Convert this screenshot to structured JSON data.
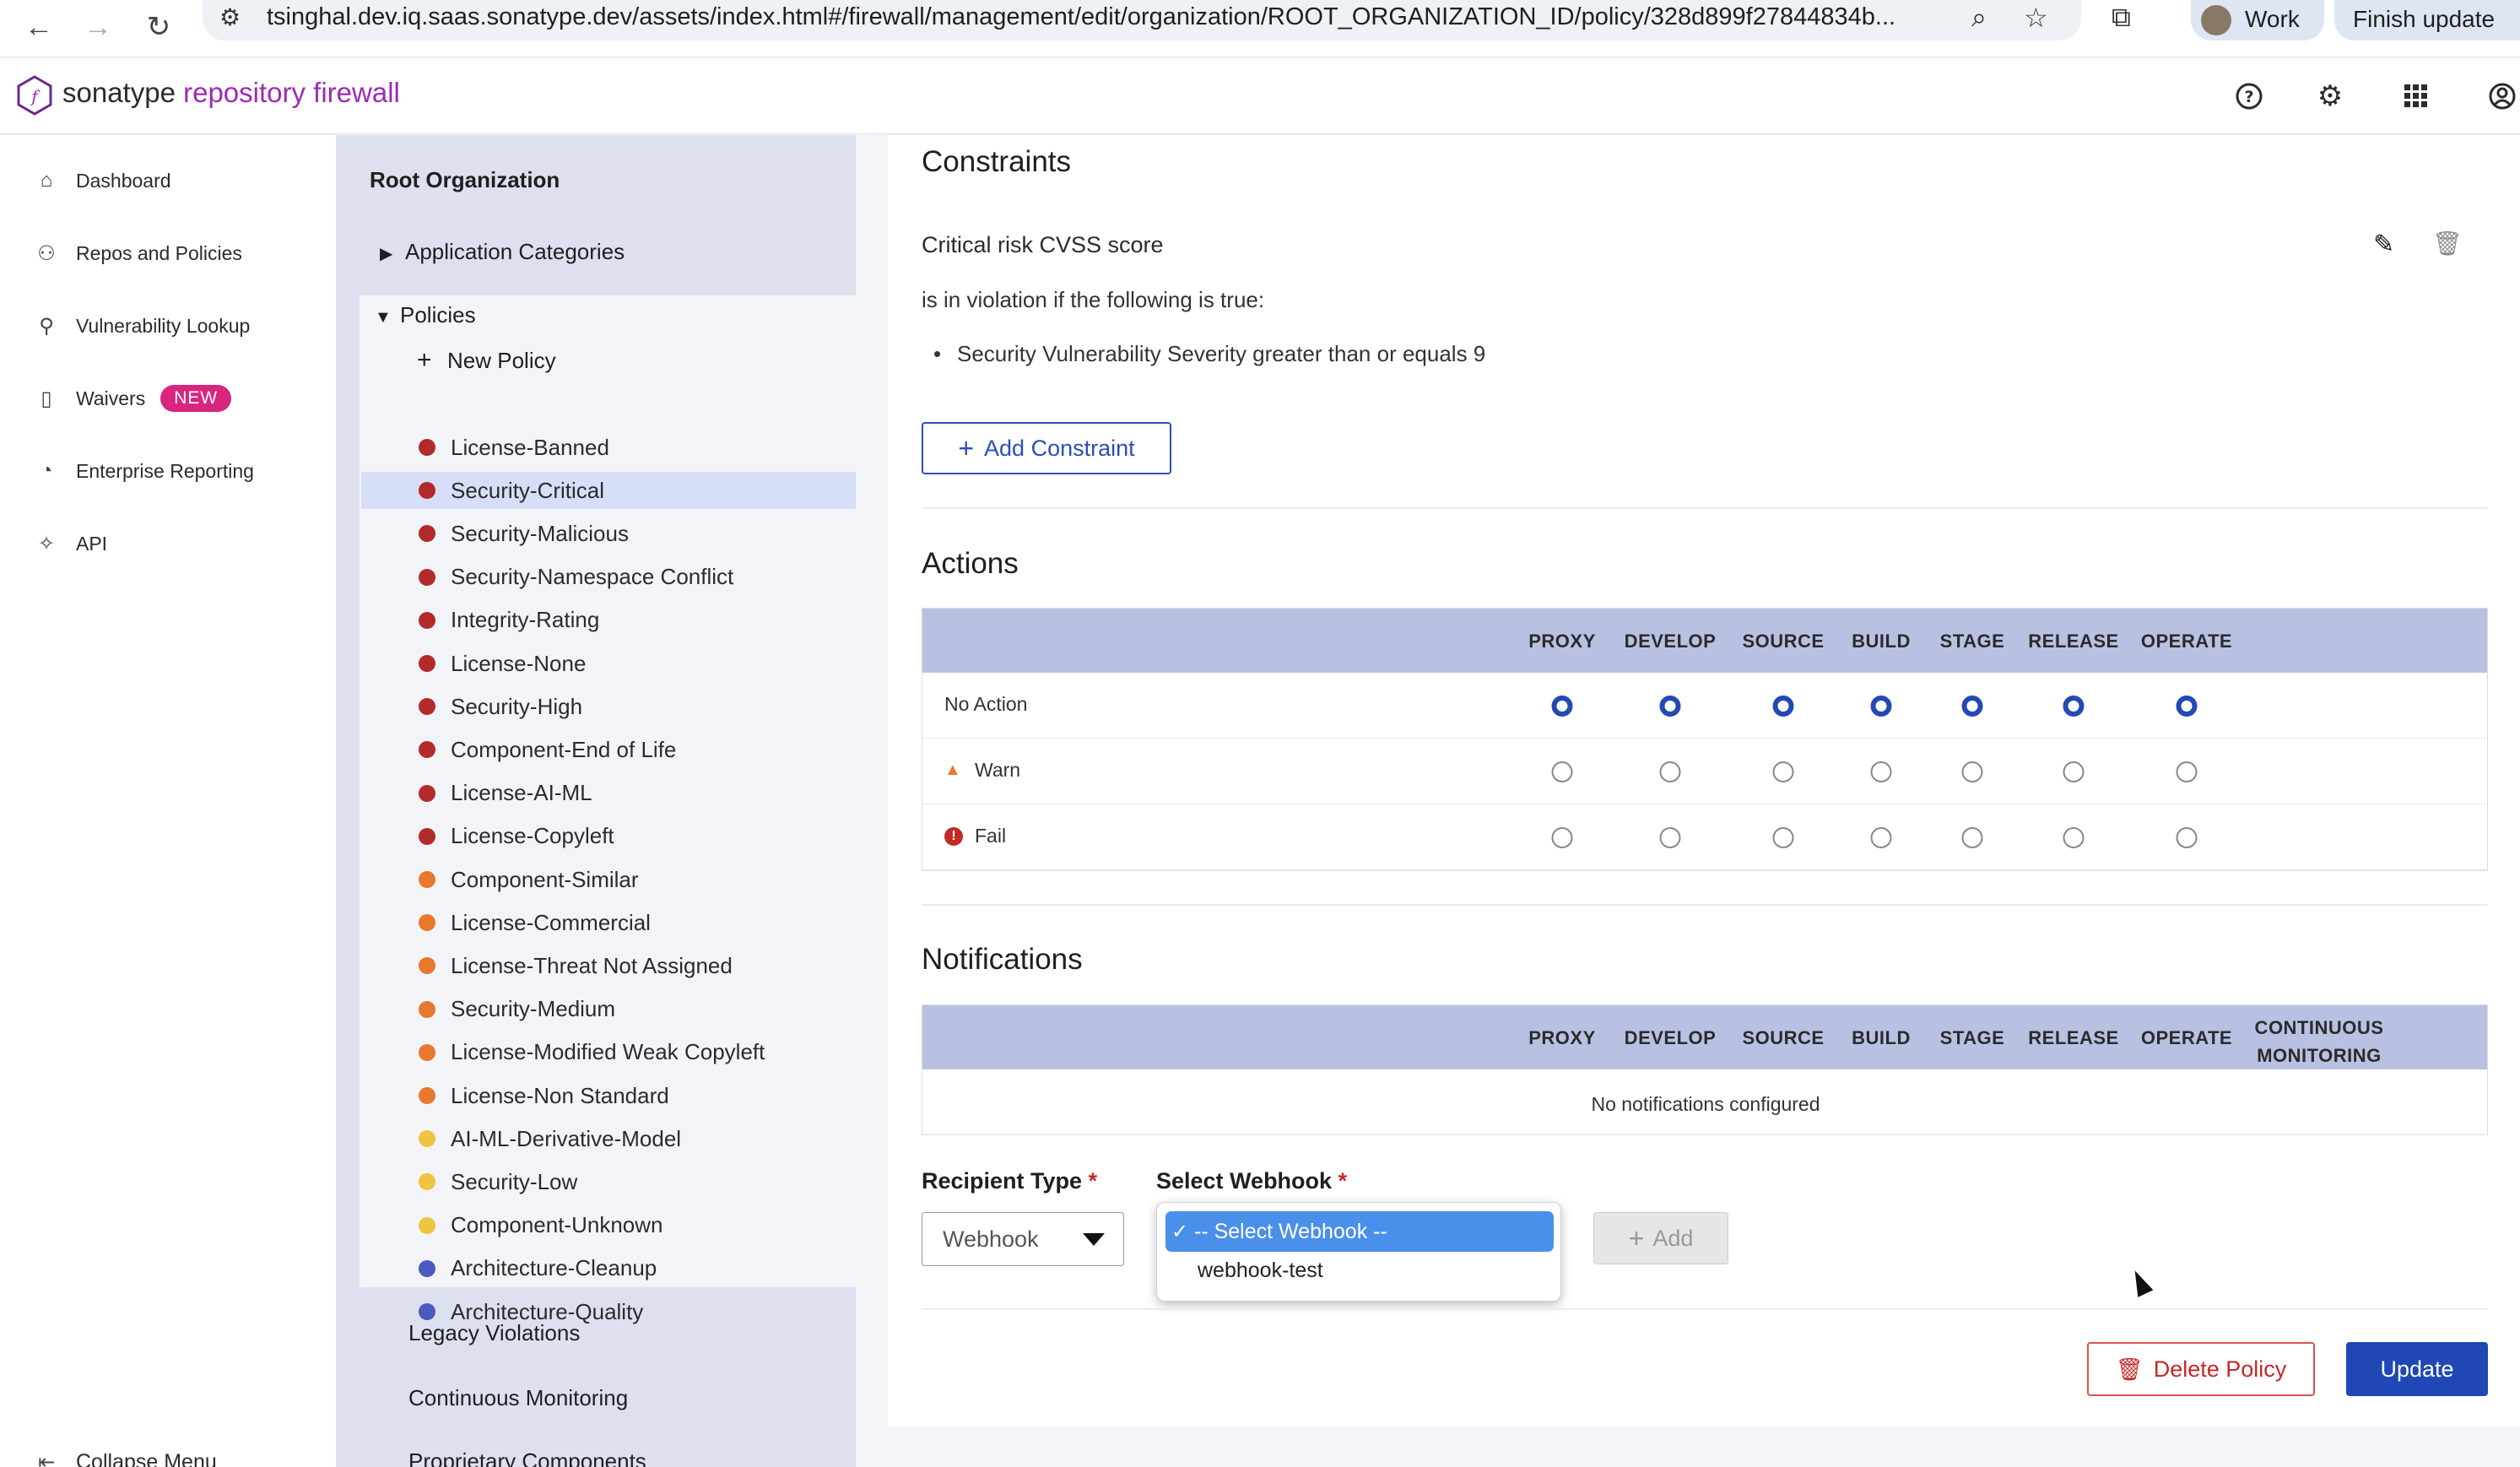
{
  "browser": {
    "url": "tsinghal.dev.iq.saas.sonatype.dev/assets/index.html#/firewall/management/edit/organization/ROOT_ORGANIZATION_ID/policy/328d899f27844834b...",
    "profile_label": "Work",
    "finish_update_label": "Finish update"
  },
  "app": {
    "brand_part1": "sonatype",
    "brand_part2": "repository firewall"
  },
  "leftnav": {
    "items": [
      {
        "label": "Dashboard"
      },
      {
        "label": "Repos and Policies"
      },
      {
        "label": "Vulnerability Lookup"
      },
      {
        "label": "Waivers",
        "badge": "NEW"
      },
      {
        "label": "Enterprise Reporting"
      },
      {
        "label": "API"
      }
    ],
    "collapse_label": "Collapse Menu"
  },
  "tree": {
    "root_label": "Root Organization",
    "app_categories_label": "Application Categories",
    "policies_label": "Policies",
    "new_policy_label": "New Policy",
    "policies": [
      {
        "name": "License-Banned",
        "color": "#b22a2a"
      },
      {
        "name": "Security-Critical",
        "color": "#b22a2a"
      },
      {
        "name": "Security-Malicious",
        "color": "#b22a2a"
      },
      {
        "name": "Security-Namespace Conflict",
        "color": "#b22a2a"
      },
      {
        "name": "Integrity-Rating",
        "color": "#b22a2a"
      },
      {
        "name": "License-None",
        "color": "#b22a2a"
      },
      {
        "name": "Security-High",
        "color": "#b22a2a"
      },
      {
        "name": "Component-End of Life",
        "color": "#b22a2a"
      },
      {
        "name": "License-AI-ML",
        "color": "#b22a2a"
      },
      {
        "name": "License-Copyleft",
        "color": "#b22a2a"
      },
      {
        "name": "Component-Similar",
        "color": "#e8782e"
      },
      {
        "name": "License-Commercial",
        "color": "#e8782e"
      },
      {
        "name": "License-Threat Not Assigned",
        "color": "#e8782e"
      },
      {
        "name": "Security-Medium",
        "color": "#e8782e"
      },
      {
        "name": "License-Modified Weak Copyleft",
        "color": "#e8782e"
      },
      {
        "name": "License-Non Standard",
        "color": "#e8782e"
      },
      {
        "name": "AI-ML-Derivative-Model",
        "color": "#f0c340"
      },
      {
        "name": "Security-Low",
        "color": "#f0c340"
      },
      {
        "name": "Component-Unknown",
        "color": "#f0c340"
      },
      {
        "name": "Architecture-Cleanup",
        "color": "#4a5bbf"
      },
      {
        "name": "Architecture-Quality",
        "color": "#4a5bbf"
      }
    ],
    "selected_policy": "Security-Critical",
    "legacy_label": "Legacy Violations",
    "continuous_label": "Continuous Monitoring",
    "proprietary_label": "Proprietary Components"
  },
  "constraints": {
    "title": "Constraints",
    "constraint_name": "Critical risk CVSS score",
    "condition_intro": "is in violation if the following is true:",
    "conditions": [
      "Security Vulnerability Severity greater than or equals 9"
    ],
    "add_label": "Add Constraint"
  },
  "actions": {
    "title": "Actions",
    "columns": [
      "PROXY",
      "DEVELOP",
      "SOURCE",
      "BUILD",
      "STAGE",
      "RELEASE",
      "OPERATE"
    ],
    "rows": [
      {
        "label": "No Action",
        "selected": true
      },
      {
        "label": "Warn",
        "selected": false
      },
      {
        "label": "Fail",
        "selected": false
      }
    ]
  },
  "notifications": {
    "title": "Notifications",
    "columns": [
      "PROXY",
      "DEVELOP",
      "SOURCE",
      "BUILD",
      "STAGE",
      "RELEASE",
      "OPERATE"
    ],
    "continuous_col_line1": "CONTINUOUS",
    "continuous_col_line2": "MONITORING",
    "empty_text": "No notifications configured",
    "recipient_label": "Recipient Type",
    "recipient_value": "Webhook",
    "webhook_label": "Select Webhook",
    "required_mark": "*",
    "webhook_options": [
      "-- Select Webhook --",
      "webhook-test"
    ],
    "add_label": "Add"
  },
  "footer": {
    "delete_label": "Delete Policy",
    "update_label": "Update"
  },
  "colors": {
    "accent": "#2349b3",
    "brand": "#9b2bb5",
    "badge": "#d8257f"
  }
}
